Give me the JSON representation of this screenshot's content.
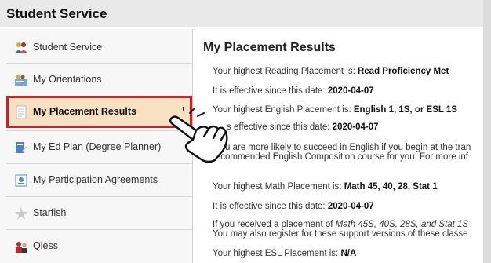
{
  "header": {
    "title": "Student Service"
  },
  "sidebar": {
    "items": [
      {
        "label": "Student Service",
        "icon": "students-icon"
      },
      {
        "label": "My Orientations",
        "icon": "orientation-icon"
      },
      {
        "label": "My Placement Results",
        "icon": "document-icon",
        "active": true
      },
      {
        "label": "My Ed Plan (Degree Planner)",
        "icon": "planner-icon"
      },
      {
        "label": "My Participation Agreements",
        "icon": "agreement-icon"
      },
      {
        "label": "Starfish",
        "icon": "starfish-icon"
      },
      {
        "label": "Qless",
        "icon": "queue-icon"
      }
    ]
  },
  "content": {
    "title": "My Placement Results",
    "reading": {
      "prefix": "Your highest Reading Placement is: ",
      "value": "Read Proficiency Met"
    },
    "reading_date": {
      "prefix": "It is effective since this date: ",
      "value": "2020-04-07"
    },
    "english": {
      "prefix": "Your highest English Placement is: ",
      "value": "English 1, 1S, or ESL 1S"
    },
    "english_date": {
      "prefix": "s effective since this date: ",
      "value": "2020-04-07"
    },
    "english_note_1": "u are more likely to succeed in English if you begin at the tran",
    "english_note_2": "recommended English Composition course for you. For more inf",
    "math": {
      "prefix": "Your highest Math Placement is: ",
      "value": "Math 45, 40, 28, Stat 1"
    },
    "math_date": {
      "prefix": "It is effective since this date: ",
      "value": "2020-04-07"
    },
    "math_note_1_prefix": "If you received a placement of ",
    "math_note_1_italic": "Math 45S, 40S, 28S, and Stat 1S",
    "math_note_2": "You may also register for these support versions of these classe",
    "esl": {
      "prefix": "Your highest ESL Placement is: ",
      "value": "N/A"
    }
  },
  "colors": {
    "active_border": "#c0262d",
    "active_fill": "#f7e1c2"
  }
}
